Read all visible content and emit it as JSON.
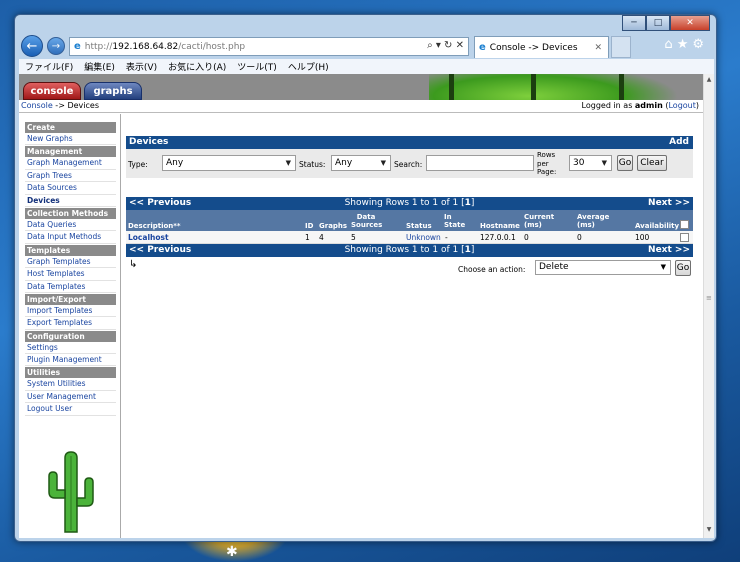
{
  "browser": {
    "url_prefix": "http://",
    "url_host": "192.168.64.82",
    "url_path": "/cacti/host.php",
    "tab_title": "Console -> Devices",
    "caption_minimize": "─",
    "caption_maximize": "□",
    "caption_close": "✕",
    "menu": [
      "ファイル(F)",
      "編集(E)",
      "表示(V)",
      "お気に入り(A)",
      "ツール(T)",
      "ヘルプ(H)"
    ]
  },
  "header": {
    "console_tab": "console",
    "graphs_tab": "graphs",
    "breadcrumb_link": "Console",
    "breadcrumb_sep": " -> ",
    "breadcrumb_current": "Devices",
    "logged_prefix": "Logged in as ",
    "logged_user": "admin",
    "logout_open": " (",
    "logout_label": "Logout",
    "logout_close": ")"
  },
  "sidebar": {
    "sections": [
      {
        "title": "Create",
        "items": [
          "New Graphs"
        ]
      },
      {
        "title": "Management",
        "items": [
          "Graph Management",
          "Graph Trees",
          "Data Sources",
          "Devices"
        ]
      },
      {
        "title": "Collection Methods",
        "items": [
          "Data Queries",
          "Data Input Methods"
        ]
      },
      {
        "title": "Templates",
        "items": [
          "Graph Templates",
          "Host Templates",
          "Data Templates"
        ]
      },
      {
        "title": "Import/Export",
        "items": [
          "Import Templates",
          "Export Templates"
        ]
      },
      {
        "title": "Configuration",
        "items": [
          "Settings",
          "Plugin Management"
        ]
      },
      {
        "title": "Utilities",
        "items": [
          "System Utilities",
          "User Management",
          "Logout User"
        ]
      }
    ],
    "active_item": "Devices"
  },
  "devices": {
    "title": "Devices",
    "add_label": "Add",
    "filter": {
      "type_label": "Type:",
      "type_value": "Any",
      "status_label": "Status:",
      "status_value": "Any",
      "search_label": "Search:",
      "search_value": "",
      "rows_label_1": "Rows",
      "rows_label_2": "per",
      "rows_label_3": "Page:",
      "rows_value": "30",
      "go_label": "Go",
      "clear_label": "Clear"
    },
    "nav": {
      "prev": "<< Previous",
      "showing_prefix": "Showing Rows 1 to 1 of 1 [",
      "showing_page": "1",
      "showing_suffix": "]",
      "next": "Next >>"
    },
    "columns": {
      "description": "Description**",
      "id": "ID",
      "graphs": "Graphs",
      "data_sources_1": "Data",
      "data_sources_2": "Sources",
      "status": "Status",
      "in_state_1": "In",
      "in_state_2": "State",
      "hostname": "Hostname",
      "current_1": "Current",
      "current_2": "(ms)",
      "average_1": "Average",
      "average_2": "(ms)",
      "availability": "Availability"
    },
    "rows": [
      {
        "description": "Localhost",
        "id": "1",
        "graphs": "4",
        "data_sources": "5",
        "status": "Unknown",
        "in_state": "-",
        "hostname": "127.0.0.1",
        "current": "0",
        "average": "0",
        "availability": "100"
      }
    ],
    "action": {
      "arrow": "↳",
      "label": "Choose an action:",
      "value": "Delete",
      "go_label": "Go"
    }
  }
}
